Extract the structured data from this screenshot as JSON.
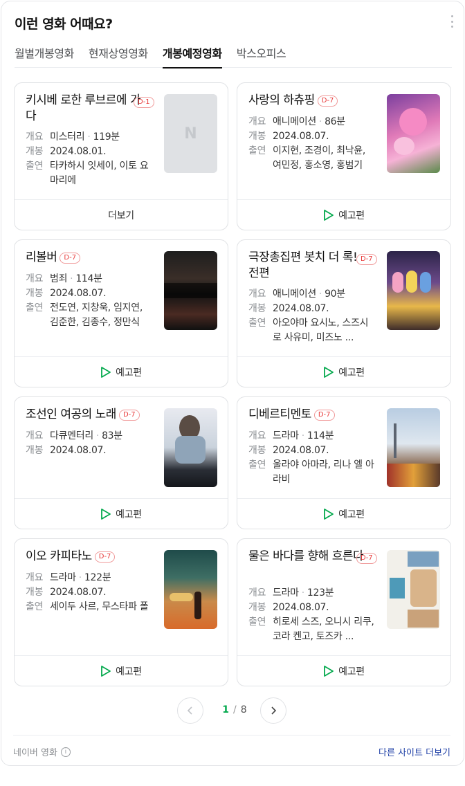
{
  "header": {
    "title": "이런 영화 어때요?"
  },
  "tabs": [
    "월별개봉영화",
    "현재상영영화",
    "개봉예정영화",
    "박스오피스"
  ],
  "active_tab": 2,
  "labels": {
    "genre": "개요",
    "release": "개봉",
    "cast": "출연",
    "more": "더보기",
    "trailer": "예고편"
  },
  "movies": [
    {
      "title": "키시베 로한 루브르에 가다",
      "badge": "D-1",
      "genre": "미스터리",
      "runtime": "119분",
      "release": "2024.08.01.",
      "cast": "타카하시 잇세이, 이토 요 마리에",
      "action": "더보기"
    },
    {
      "title": "사랑의 하츄핑",
      "badge": "D-7",
      "genre": "애니메이션",
      "runtime": "86분",
      "release": "2024.08.07.",
      "cast": "이지현, 조경이, 최낙윤, 여민정, 홍소영, 홍범기",
      "action": "예고편"
    },
    {
      "title": "리볼버",
      "badge": "D-7",
      "genre": "범죄",
      "runtime": "114분",
      "release": "2024.08.07.",
      "cast": "전도연, 지창욱, 임지연, 김준한, 김종수, 정만식",
      "action": "예고편"
    },
    {
      "title": "극장총집편 봇치 더 록! 전편",
      "badge": "D-7",
      "genre": "애니메이션",
      "runtime": "90분",
      "release": "2024.08.07.",
      "cast": "아오야마 요시노, 스즈시로 사유미, 미즈노 ...",
      "action": "예고편"
    },
    {
      "title": "조선인 여공의 노래",
      "badge": "D-7",
      "genre": "다큐멘터리",
      "runtime": "83분",
      "release": "2024.08.07.",
      "cast": "",
      "action": "예고편"
    },
    {
      "title": "디베르티멘토",
      "badge": "D-7",
      "genre": "드라마",
      "runtime": "114분",
      "release": "2024.08.07.",
      "cast": "울라야 아마라, 리나 엘 아라비",
      "action": "예고편"
    },
    {
      "title": "이오 카피타노",
      "badge": "D-7",
      "genre": "드라마",
      "runtime": "122분",
      "release": "2024.08.07.",
      "cast": "세이두 사르, 무스타파 폴",
      "action": "예고편"
    },
    {
      "title": "물은 바다를 향해 흐른다",
      "badge": "D-7",
      "genre": "드라마",
      "runtime": "123분",
      "release": "2024.08.07.",
      "cast": "히로세 스즈, 오니시 리쿠, 코라 켄고, 토즈카 ...",
      "action": "예고편"
    }
  ],
  "pagination": {
    "current": "1",
    "separator": "/",
    "total": "8"
  },
  "footer": {
    "source": "네이버 영화",
    "info_glyph": "i",
    "more_sites": "다른 사이트 더보기"
  },
  "colors": {
    "active_page": "#03a94d",
    "badge": "#e83a3a",
    "link": "#1e3fa6",
    "trailer_icon": "#03a94d"
  },
  "icons": {
    "trailer": "play-outline-icon",
    "prev": "chevron-left-icon",
    "next": "chevron-right-icon",
    "info": "info-circle-icon",
    "menu": "more-vertical-icon"
  }
}
